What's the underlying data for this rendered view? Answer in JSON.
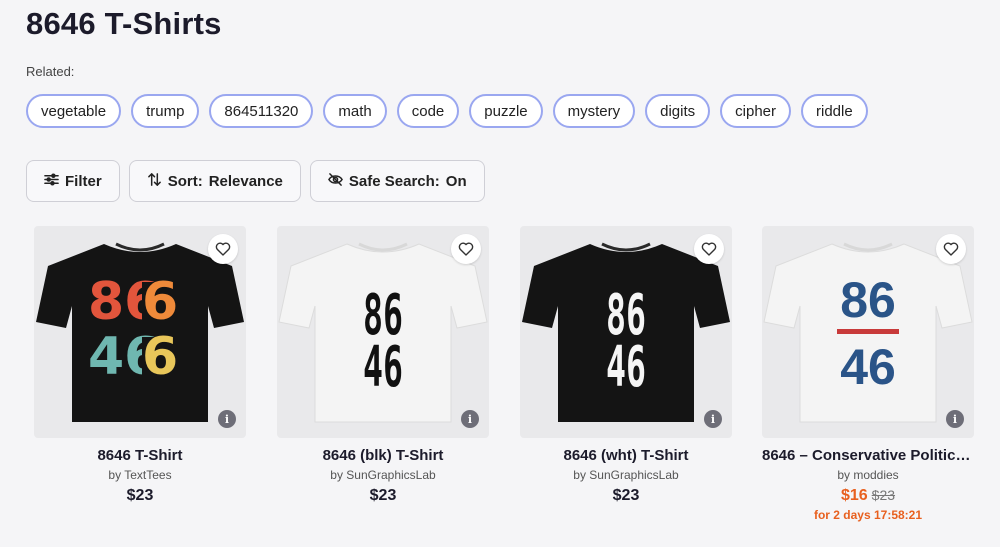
{
  "page": {
    "title": "8646 T-Shirts",
    "related_label": "Related:"
  },
  "related_tags": [
    "vegetable",
    "trump",
    "864511320",
    "math",
    "code",
    "puzzle",
    "mystery",
    "digits",
    "cipher",
    "riddle"
  ],
  "controls": {
    "filter_label": "Filter",
    "sort_label": "Sort:",
    "sort_value": "Relevance",
    "safe_label": "Safe Search:",
    "safe_value": "On"
  },
  "products": [
    {
      "title": "8646 T-Shirt",
      "artist": "by TextTees",
      "price": "$23",
      "shirt_color": "#141414",
      "design": "retro"
    },
    {
      "title": "8646 (blk) T-Shirt",
      "artist": "by SunGraphicsLab",
      "price": "$23",
      "shirt_color": "#f2f2f2",
      "design": "stencil-black"
    },
    {
      "title": "8646 (wht) T-Shirt",
      "artist": "by SunGraphicsLab",
      "price": "$23",
      "shirt_color": "#141414",
      "design": "stencil-white"
    },
    {
      "title": "8646 – Conservative Political...",
      "artist": "by moddies",
      "sale_price": "$16",
      "original_price": "$23",
      "countdown": "for 2 days 17:58:21",
      "shirt_color": "#f2f2f2",
      "design": "blue-red"
    }
  ],
  "design_text": {
    "top": "86",
    "bottom": "46"
  },
  "colors": {
    "tag_border": "#9aa7f0",
    "sale": "#e8601f",
    "blue": "#2a5488",
    "red": "#c83a3a"
  }
}
